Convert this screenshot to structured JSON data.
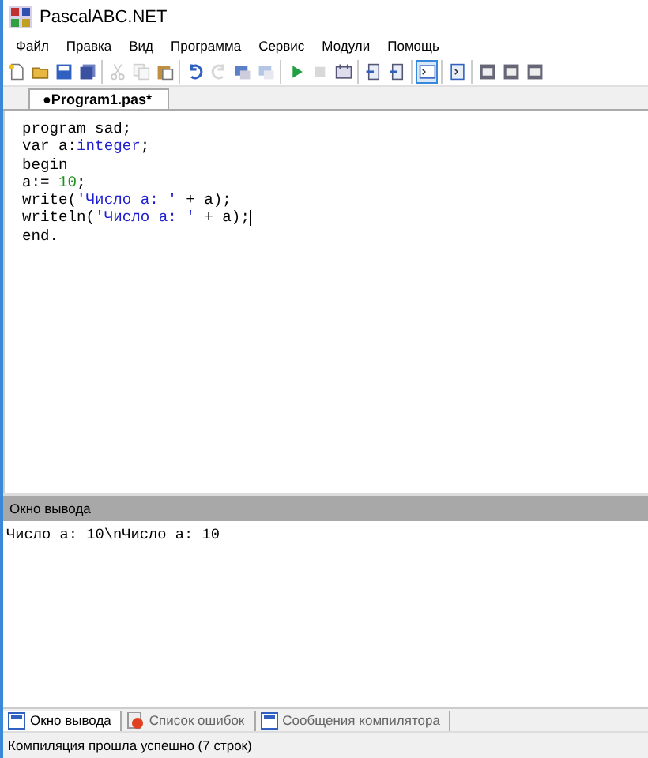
{
  "window": {
    "title": "PascalABC.NET"
  },
  "menu": [
    "Файл",
    "Правка",
    "Вид",
    "Программа",
    "Сервис",
    "Модули",
    "Помощь"
  ],
  "toolbar": [
    [
      {
        "kind": "new",
        "disabled": false,
        "selected": false
      },
      {
        "kind": "open",
        "disabled": false,
        "selected": false
      },
      {
        "kind": "save",
        "disabled": false,
        "selected": false
      },
      {
        "kind": "saveall",
        "disabled": false,
        "selected": false
      }
    ],
    [
      {
        "kind": "cut",
        "disabled": true,
        "selected": false
      },
      {
        "kind": "copy",
        "disabled": true,
        "selected": false
      },
      {
        "kind": "paste",
        "disabled": false,
        "selected": false
      }
    ],
    [
      {
        "kind": "undo",
        "disabled": false,
        "selected": false
      },
      {
        "kind": "redo",
        "disabled": true,
        "selected": false
      },
      {
        "kind": "form",
        "disabled": false,
        "selected": false
      },
      {
        "kind": "form",
        "disabled": true,
        "selected": false
      }
    ],
    [
      {
        "kind": "run",
        "disabled": false,
        "selected": false
      },
      {
        "kind": "stop",
        "disabled": true,
        "selected": false
      },
      {
        "kind": "debug",
        "disabled": false,
        "selected": false
      }
    ],
    [
      {
        "kind": "step",
        "disabled": false,
        "selected": false
      },
      {
        "kind": "stepin",
        "disabled": false,
        "selected": false
      }
    ],
    [
      {
        "kind": "console",
        "disabled": false,
        "selected": true
      }
    ],
    [
      {
        "kind": "panel",
        "disabled": false,
        "selected": false
      }
    ],
    [
      {
        "kind": "window",
        "disabled": false,
        "selected": false
      },
      {
        "kind": "window",
        "disabled": false,
        "selected": false
      },
      {
        "kind": "window",
        "disabled": false,
        "selected": false
      }
    ]
  ],
  "editor_tabs": [
    {
      "label": "●Program1.pas*",
      "selected": true
    }
  ],
  "code": [
    [
      {
        "text": "program sad;",
        "kind": "plain"
      }
    ],
    [
      {
        "text": "var a:",
        "kind": "plain"
      },
      {
        "text": "integer",
        "kind": "type"
      },
      {
        "text": ";",
        "kind": "plain"
      }
    ],
    [
      {
        "text": "begin",
        "kind": "plain"
      }
    ],
    [
      {
        "text": "a:= ",
        "kind": "plain"
      },
      {
        "text": "10",
        "kind": "number"
      },
      {
        "text": ";",
        "kind": "plain"
      }
    ],
    [
      {
        "text": "write(",
        "kind": "plain"
      },
      {
        "text": "'Число a: '",
        "kind": "string"
      },
      {
        "text": " + a);",
        "kind": "plain"
      }
    ],
    [
      {
        "text": "writeln(",
        "kind": "plain"
      },
      {
        "text": "'Число a: '",
        "kind": "string"
      },
      {
        "text": " + a);",
        "kind": "plain"
      }
    ],
    [
      {
        "text": "end.",
        "kind": "plain"
      }
    ]
  ],
  "output": {
    "title": "Окно вывода",
    "text": "Число a: 10\\nЧисло a: 10"
  },
  "bottom_tabs": [
    {
      "label": "Окно вывода",
      "kind": "output",
      "selected": true
    },
    {
      "label": "Список ошибок",
      "kind": "errors",
      "selected": false
    },
    {
      "label": "Сообщения компилятора",
      "kind": "messages",
      "selected": false
    }
  ],
  "status_bar": "Компиляция прошла успешно (7 строк)"
}
